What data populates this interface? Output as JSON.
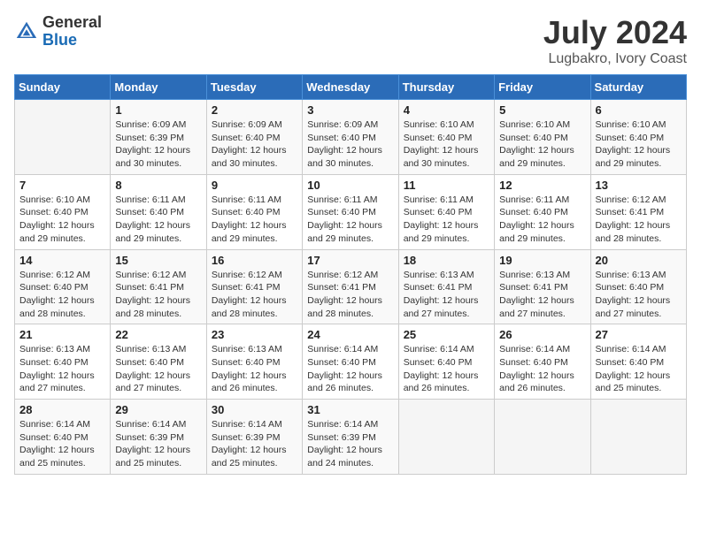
{
  "header": {
    "logo_general": "General",
    "logo_blue": "Blue",
    "month_title": "July 2024",
    "location": "Lugbakro, Ivory Coast"
  },
  "days_of_week": [
    "Sunday",
    "Monday",
    "Tuesday",
    "Wednesday",
    "Thursday",
    "Friday",
    "Saturday"
  ],
  "weeks": [
    [
      {
        "day": "",
        "info": ""
      },
      {
        "day": "1",
        "info": "Sunrise: 6:09 AM\nSunset: 6:39 PM\nDaylight: 12 hours\nand 30 minutes."
      },
      {
        "day": "2",
        "info": "Sunrise: 6:09 AM\nSunset: 6:40 PM\nDaylight: 12 hours\nand 30 minutes."
      },
      {
        "day": "3",
        "info": "Sunrise: 6:09 AM\nSunset: 6:40 PM\nDaylight: 12 hours\nand 30 minutes."
      },
      {
        "day": "4",
        "info": "Sunrise: 6:10 AM\nSunset: 6:40 PM\nDaylight: 12 hours\nand 30 minutes."
      },
      {
        "day": "5",
        "info": "Sunrise: 6:10 AM\nSunset: 6:40 PM\nDaylight: 12 hours\nand 29 minutes."
      },
      {
        "day": "6",
        "info": "Sunrise: 6:10 AM\nSunset: 6:40 PM\nDaylight: 12 hours\nand 29 minutes."
      }
    ],
    [
      {
        "day": "7",
        "info": ""
      },
      {
        "day": "8",
        "info": "Sunrise: 6:11 AM\nSunset: 6:40 PM\nDaylight: 12 hours\nand 29 minutes."
      },
      {
        "day": "9",
        "info": "Sunrise: 6:11 AM\nSunset: 6:40 PM\nDaylight: 12 hours\nand 29 minutes."
      },
      {
        "day": "10",
        "info": "Sunrise: 6:11 AM\nSunset: 6:40 PM\nDaylight: 12 hours\nand 29 minutes."
      },
      {
        "day": "11",
        "info": "Sunrise: 6:11 AM\nSunset: 6:40 PM\nDaylight: 12 hours\nand 29 minutes."
      },
      {
        "day": "12",
        "info": "Sunrise: 6:11 AM\nSunset: 6:40 PM\nDaylight: 12 hours\nand 29 minutes."
      },
      {
        "day": "13",
        "info": "Sunrise: 6:12 AM\nSunset: 6:41 PM\nDaylight: 12 hours\nand 28 minutes."
      }
    ],
    [
      {
        "day": "14",
        "info": ""
      },
      {
        "day": "15",
        "info": "Sunrise: 6:12 AM\nSunset: 6:41 PM\nDaylight: 12 hours\nand 28 minutes."
      },
      {
        "day": "16",
        "info": "Sunrise: 6:12 AM\nSunset: 6:41 PM\nDaylight: 12 hours\nand 28 minutes."
      },
      {
        "day": "17",
        "info": "Sunrise: 6:12 AM\nSunset: 6:41 PM\nDaylight: 12 hours\nand 28 minutes."
      },
      {
        "day": "18",
        "info": "Sunrise: 6:13 AM\nSunset: 6:41 PM\nDaylight: 12 hours\nand 27 minutes."
      },
      {
        "day": "19",
        "info": "Sunrise: 6:13 AM\nSunset: 6:41 PM\nDaylight: 12 hours\nand 27 minutes."
      },
      {
        "day": "20",
        "info": "Sunrise: 6:13 AM\nSunset: 6:40 PM\nDaylight: 12 hours\nand 27 minutes."
      }
    ],
    [
      {
        "day": "21",
        "info": ""
      },
      {
        "day": "22",
        "info": "Sunrise: 6:13 AM\nSunset: 6:40 PM\nDaylight: 12 hours\nand 27 minutes."
      },
      {
        "day": "23",
        "info": "Sunrise: 6:13 AM\nSunset: 6:40 PM\nDaylight: 12 hours\nand 26 minutes."
      },
      {
        "day": "24",
        "info": "Sunrise: 6:14 AM\nSunset: 6:40 PM\nDaylight: 12 hours\nand 26 minutes."
      },
      {
        "day": "25",
        "info": "Sunrise: 6:14 AM\nSunset: 6:40 PM\nDaylight: 12 hours\nand 26 minutes."
      },
      {
        "day": "26",
        "info": "Sunrise: 6:14 AM\nSunset: 6:40 PM\nDaylight: 12 hours\nand 26 minutes."
      },
      {
        "day": "27",
        "info": "Sunrise: 6:14 AM\nSunset: 6:40 PM\nDaylight: 12 hours\nand 25 minutes."
      }
    ],
    [
      {
        "day": "28",
        "info": "Sunrise: 6:14 AM\nSunset: 6:40 PM\nDaylight: 12 hours\nand 25 minutes."
      },
      {
        "day": "29",
        "info": "Sunrise: 6:14 AM\nSunset: 6:39 PM\nDaylight: 12 hours\nand 25 minutes."
      },
      {
        "day": "30",
        "info": "Sunrise: 6:14 AM\nSunset: 6:39 PM\nDaylight: 12 hours\nand 25 minutes."
      },
      {
        "day": "31",
        "info": "Sunrise: 6:14 AM\nSunset: 6:39 PM\nDaylight: 12 hours\nand 24 minutes."
      },
      {
        "day": "",
        "info": ""
      },
      {
        "day": "",
        "info": ""
      },
      {
        "day": "",
        "info": ""
      }
    ]
  ],
  "week7_sun_info": "Sunrise: 6:10 AM\nSunset: 6:40 PM\nDaylight: 12 hours\nand 29 minutes.",
  "week14_sun_info": "Sunrise: 6:12 AM\nSunset: 6:40 PM\nDaylight: 12 hours\nand 28 minutes.",
  "week21_sun_info": "Sunrise: 6:13 AM\nSunset: 6:40 PM\nDaylight: 12 hours\nand 27 minutes."
}
